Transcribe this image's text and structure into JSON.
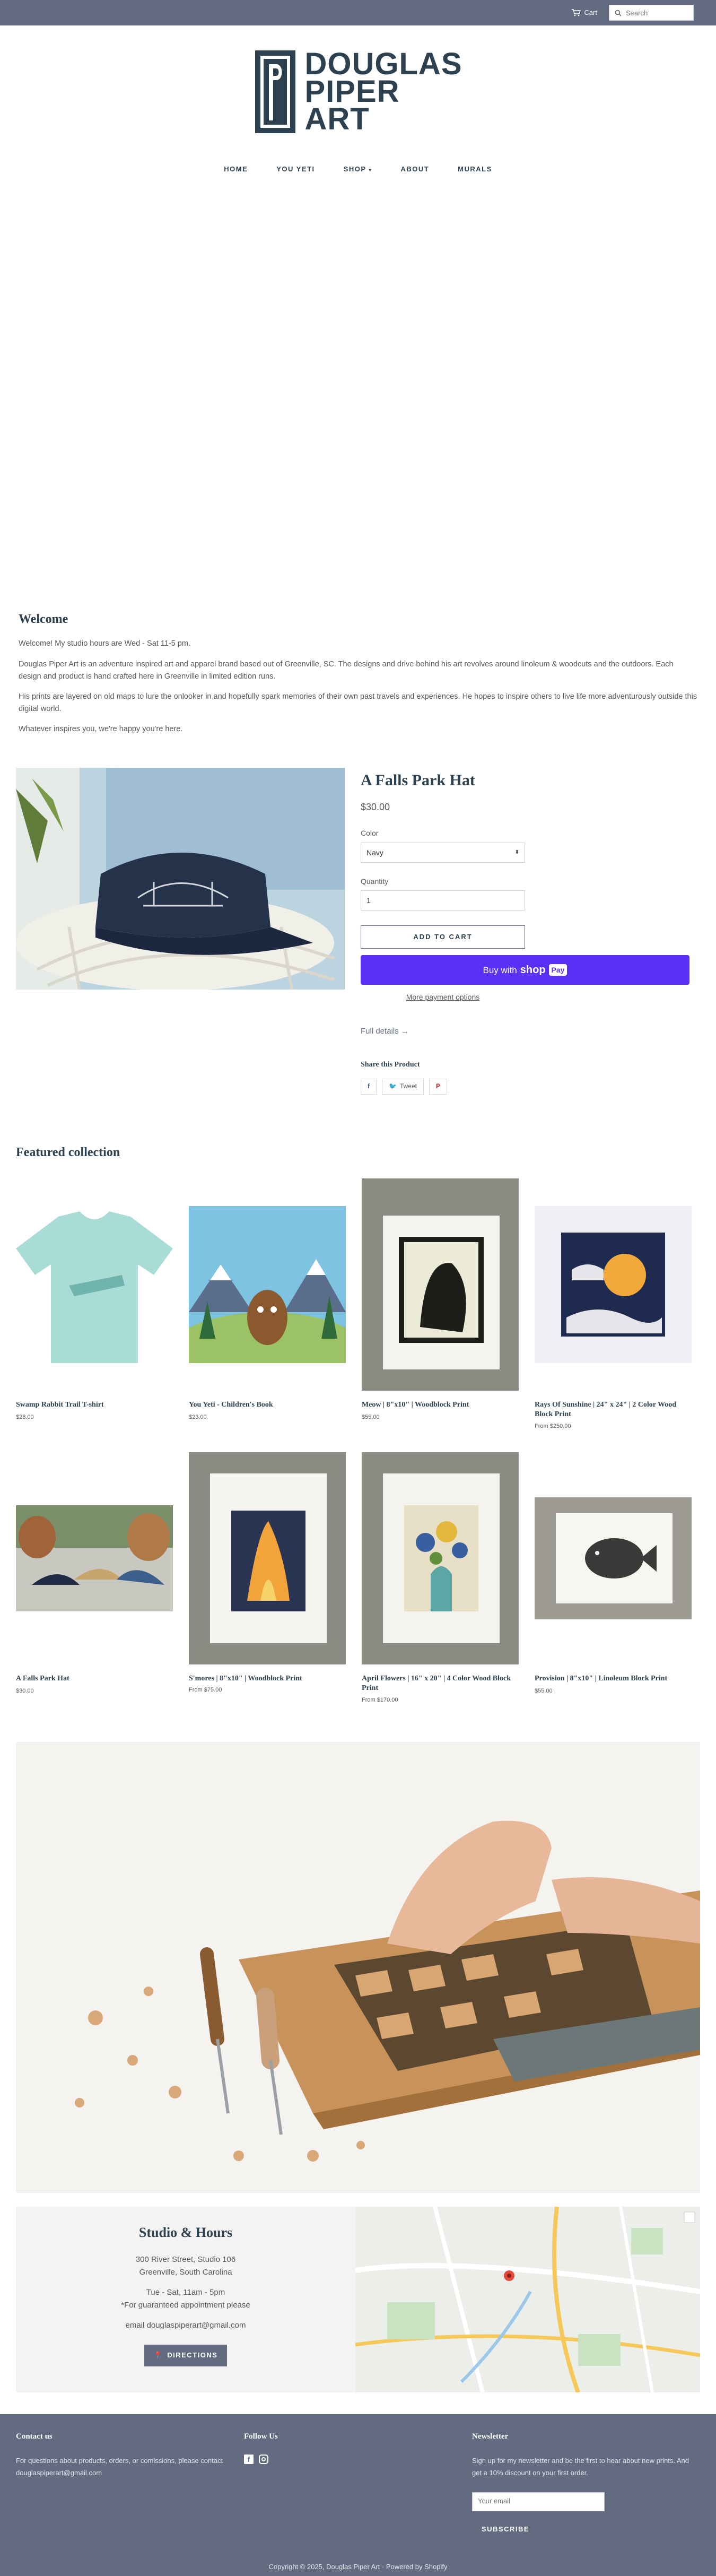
{
  "topbar": {
    "cart_label": "Cart",
    "search_placeholder": "Search"
  },
  "brand": {
    "line1": "DOUGLAS",
    "line2": "PIPER",
    "line3": "ART"
  },
  "nav": {
    "home": "HOME",
    "you_yeti": "YOU YETI",
    "shop": "SHOP",
    "about": "ABOUT",
    "murals": "MURALS"
  },
  "welcome": {
    "title": "Welcome",
    "p1": "Welcome! My studio hours are Wed - Sat 11-5 pm.",
    "p2": "Douglas Piper Art is an adventure inspired art and apparel brand based out of Greenville, SC. The designs and drive behind his art revolves around linoleum & woodcuts and the outdoors. Each design and product is hand crafted here in Greenville in limited edition runs.",
    "p3": "His prints are layered on old maps to lure the onlooker in and hopefully spark memories of their own past travels and experiences. He hopes to inspire others to live life more adventurously outside this digital world.",
    "p4": "Whatever inspires you, we're happy you're here."
  },
  "product": {
    "title": "A Falls Park Hat",
    "price": "$30.00",
    "color_label": "Color",
    "color_value": "Navy",
    "quantity_label": "Quantity",
    "quantity_value": "1",
    "add_to_cart": "ADD TO CART",
    "buy_with": "Buy with",
    "shop_word": "shop",
    "pay_word": "Pay",
    "more_payment": "More payment options",
    "full_details": "Full details →",
    "share_title": "Share this Product",
    "tweet": "Tweet"
  },
  "featured": {
    "title": "Featured collection",
    "items": [
      {
        "title": "Swamp Rabbit Trail T-shirt",
        "price": "$28.00",
        "from": ""
      },
      {
        "title": "You Yeti - Children's Book",
        "price": "$23.00",
        "from": ""
      },
      {
        "title": "Meow | 8\"x10\" | Woodblock Print",
        "price": "$55.00",
        "from": ""
      },
      {
        "title": "Rays Of Sunshine | 24\" x 24\" | 2 Color Wood Block Print",
        "price": "$250.00",
        "from": "From"
      },
      {
        "title": "A Falls Park Hat",
        "price": "$30.00",
        "from": ""
      },
      {
        "title": "S'mores | 8\"x10\" | Woodblock Print",
        "price": "$75.00",
        "from": "From"
      },
      {
        "title": "April Flowers | 16\" x 20\" | 4 Color Wood Block Print",
        "price": "$170.00",
        "from": "From"
      },
      {
        "title": "Provision | 8\"x10\" | Linoleum Block Print",
        "price": "$55.00",
        "from": ""
      }
    ]
  },
  "studio": {
    "title": "Studio & Hours",
    "addr1": "300 River Street, Studio 106",
    "addr2": "Greenville, South Carolina",
    "hours": "Tue - Sat, 11am - 5pm",
    "appt": "*For guaranteed appointment please",
    "email": "email douglaspiperart@gmail.com",
    "directions": "DIRECTIONS"
  },
  "footer": {
    "contact_title": "Contact us",
    "contact_text": "For questions about products, orders, or comissions, please contact douglaspiperart@gmail.com",
    "follow_title": "Follow Us",
    "newsletter_title": "Newsletter",
    "newsletter_text": "Sign up for my newsletter and be the first to hear about new prints. And get a 10% discount on your first order.",
    "email_placeholder": "Your email",
    "subscribe": "SUBSCRIBE",
    "copyright": "Copyright © 2025, Douglas Piper Art · Powered by Shopify"
  },
  "colors": {
    "header_bar": "#626b80",
    "brand_navy": "#2d4150",
    "shop_pay": "#5a31f4"
  }
}
